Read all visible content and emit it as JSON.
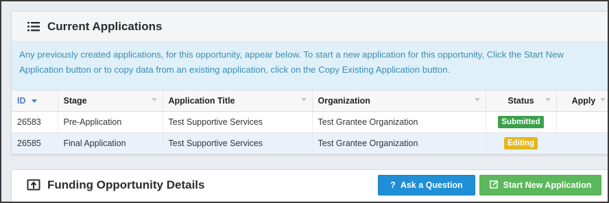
{
  "current_applications": {
    "title": "Current Applications",
    "info": "Any previously created applications, for this opportunity, appear below. To start a new application for this opportunity, Click the Start New Application button or to copy data from an existing application, click on the Copy Existing Application button.",
    "columns": [
      "ID",
      "Stage",
      "Application Title",
      "Organization",
      "Status",
      "Apply"
    ],
    "rows": [
      {
        "id": "26583",
        "stage": "Pre-Application",
        "title": "Test Supportive Services",
        "organization": "Test Grantee Organization",
        "status": "Submitted",
        "apply": ""
      },
      {
        "id": "26585",
        "stage": "Final Application",
        "title": "Test Supportive Services",
        "organization": "Test Grantee Organization",
        "status": "Editing",
        "apply": ""
      }
    ]
  },
  "funding_details": {
    "title": "Funding Opportunity Details",
    "ask_label": "Ask a Question",
    "new_label": "Start New Application"
  },
  "colors": {
    "submitted": "#3aa04a",
    "editing": "#e2b822",
    "ask_button": "#1f8fd6",
    "new_button": "#5cb85c",
    "info_bg": "#dff0f8"
  },
  "icons": {
    "current_applications": "list-icon",
    "funding_details": "upload-box-icon",
    "ask": "question-icon",
    "new": "edit-icon"
  }
}
